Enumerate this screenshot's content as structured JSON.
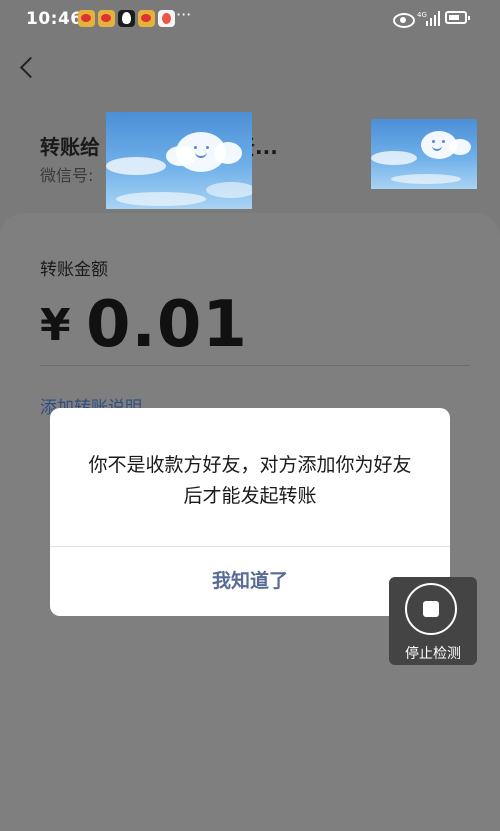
{
  "status_bar": {
    "time": "10:46",
    "more": "···",
    "network": "4G"
  },
  "recipient": {
    "transfer_to": "转账给",
    "name_suffix": "贤...",
    "wechat_id_label": "微信号:"
  },
  "amount": {
    "label": "转账金额",
    "currency": "¥",
    "value": "0.01"
  },
  "add_note": "添加转账说明",
  "dialog": {
    "message": "你不是收款方好友，对方添加你为好友后才能发起转账",
    "confirm_label": "我知道了"
  },
  "stop_detection": {
    "label": "停止检测"
  },
  "colors": {
    "link": "#576b95",
    "overlay": "#7f7f7f"
  }
}
